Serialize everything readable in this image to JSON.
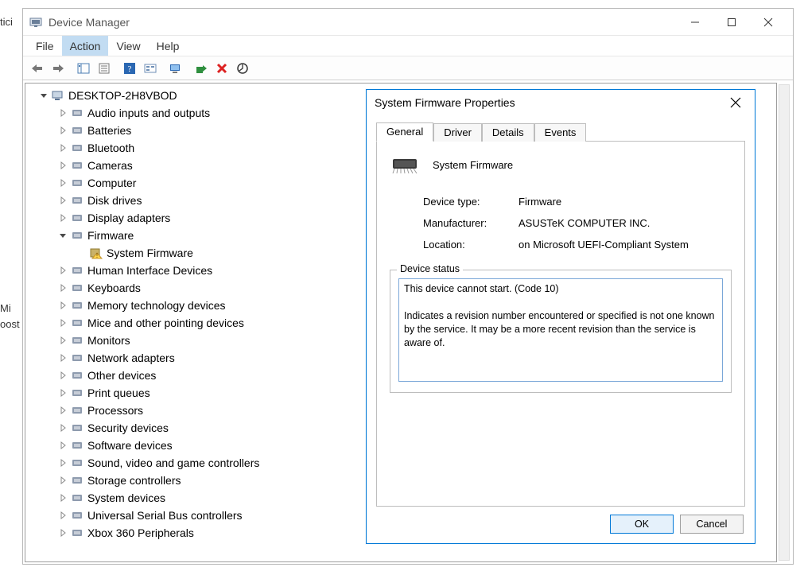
{
  "window": {
    "title": "Device Manager"
  },
  "menubar": [
    "File",
    "Action",
    "View",
    "Help"
  ],
  "menubar_selected_index": 1,
  "tree": {
    "root": "DESKTOP-2H8VBOD",
    "children": [
      "Audio inputs and outputs",
      "Batteries",
      "Bluetooth",
      "Cameras",
      "Computer",
      "Disk drives",
      "Display adapters",
      "Firmware",
      "Human Interface Devices",
      "Keyboards",
      "Memory technology devices",
      "Mice and other pointing devices",
      "Monitors",
      "Network adapters",
      "Other devices",
      "Print queues",
      "Processors",
      "Security devices",
      "Software devices",
      "Sound, video and game controllers",
      "Storage controllers",
      "System devices",
      "Universal Serial Bus controllers",
      "Xbox 360 Peripherals"
    ],
    "expanded_index": 7,
    "expanded_child": "System Firmware"
  },
  "dialog": {
    "title": "System Firmware Properties",
    "tabs": [
      "General",
      "Driver",
      "Details",
      "Events"
    ],
    "active_tab_index": 0,
    "device_name": "System Firmware",
    "props": {
      "device_type_label": "Device type:",
      "device_type_value": "Firmware",
      "manufacturer_label": "Manufacturer:",
      "manufacturer_value": "ASUSTeK COMPUTER INC.",
      "location_label": "Location:",
      "location_value": "on Microsoft UEFI-Compliant System"
    },
    "status_group_label": "Device status",
    "status_text": "This device cannot start. (Code 10)\n\nIndicates a revision number encountered or specified is not one known by the service. It may be a more recent revision than the service is aware of.",
    "ok_label": "OK",
    "cancel_label": "Cancel"
  },
  "bg_fragments": {
    "a": "tici",
    "b": "Mi",
    "c": "oost"
  }
}
